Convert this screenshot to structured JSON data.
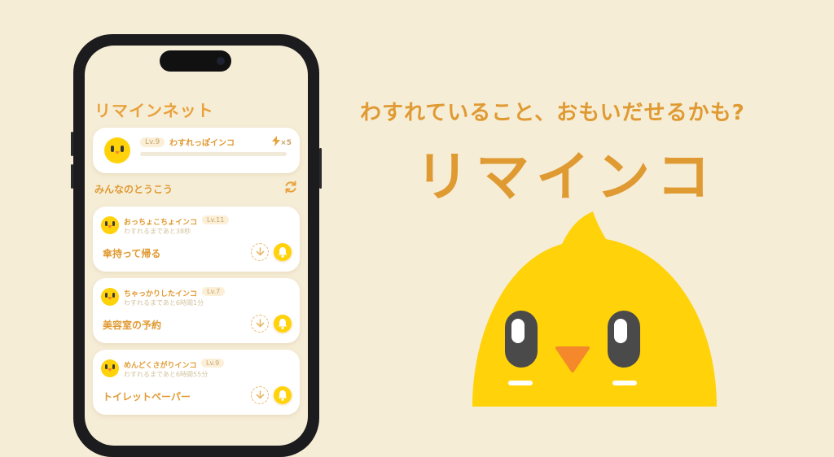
{
  "app": {
    "title": "リマインネット"
  },
  "profile": {
    "level": "Lv.9",
    "name": "わすれっぽインコ",
    "progress": 0.0,
    "energy_icon": "lightning-icon",
    "energy_count": "×5"
  },
  "feed": {
    "section_title": "みんなのとうこう",
    "refresh_icon": "refresh-icon",
    "posts": [
      {
        "author": "おっちょこちょインコ",
        "level": "Lv.11",
        "time": "わすれるまであと38秒",
        "body": "傘持って帰る"
      },
      {
        "author": "ちゃっかりしたインコ",
        "level": "Lv.7",
        "time": "わすれるまであと6時間1分",
        "body": "美容室の予約"
      },
      {
        "author": "めんどくさがりインコ",
        "level": "Lv.9",
        "time": "わすれるまであと6時間55分",
        "body": "トイレットペーパー"
      }
    ]
  },
  "promo": {
    "tagline": "わすれていること、おもいだせるかも?",
    "logo": "リマインコ"
  },
  "colors": {
    "background": "#f6edd7",
    "accent": "#e09a32",
    "bird_yellow": "#ffd20a",
    "beak_orange": "#f5882a"
  }
}
